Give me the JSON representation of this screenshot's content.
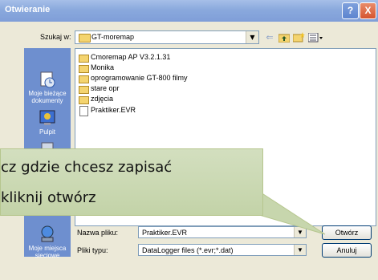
{
  "window": {
    "title": "Otwieranie",
    "help_label": "?",
    "close_label": "X"
  },
  "toolbar": {
    "lookin_label": "Szukaj w:",
    "lookin_value": "GT-moremap",
    "back_icon": "back-arrow-icon",
    "up_icon": "up-folder-icon",
    "new_folder_icon": "new-folder-icon",
    "view_icon": "view-menu-icon"
  },
  "places": [
    {
      "label": "Moje bieżące dokumenty",
      "icon": "recent-documents-icon"
    },
    {
      "label": "Pulpit",
      "icon": "desktop-icon"
    },
    {
      "label": "Moje miejsca sieciowe",
      "icon": "network-places-icon"
    }
  ],
  "files": [
    {
      "name": "Cmoremap AP V3.2.1.31",
      "type": "folder"
    },
    {
      "name": "Monika",
      "type": "folder"
    },
    {
      "name": "oprogramowanie GT-800 filmy",
      "type": "folder"
    },
    {
      "name": "stare opr",
      "type": "folder"
    },
    {
      "name": "zdjęcia",
      "type": "folder"
    },
    {
      "name": "Praktiker.EVR",
      "type": "file"
    }
  ],
  "filename": {
    "label": "Nazwa pliku:",
    "value": "Praktiker.EVR"
  },
  "filetype": {
    "label": "Pliki typu:",
    "value": "DataLogger files (*.evr;*.dat)"
  },
  "buttons": {
    "open": "Otwórz",
    "cancel": "Anuluj"
  },
  "callout": {
    "line1": "cz gdzie chcesz zapisać",
    "line2": "kliknij otwórz"
  }
}
